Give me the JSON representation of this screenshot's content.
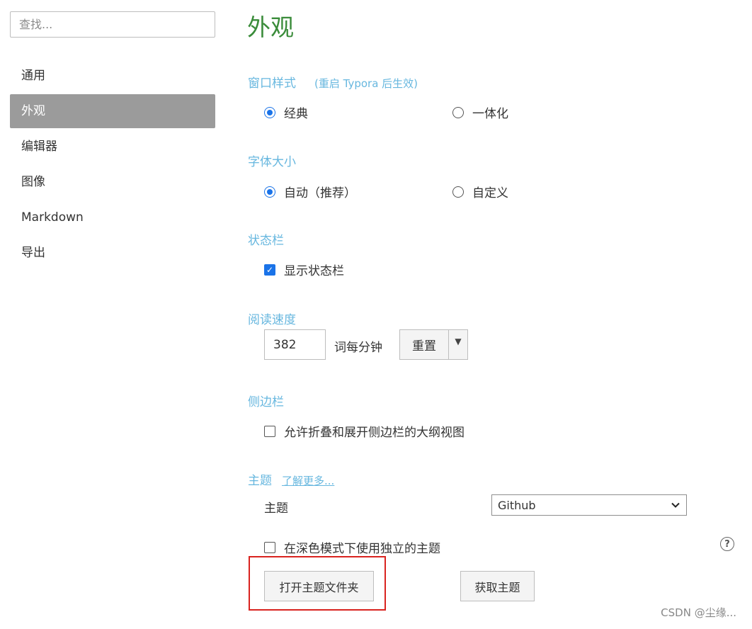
{
  "sidebar": {
    "search_placeholder": "查找...",
    "items": [
      {
        "label": "通用"
      },
      {
        "label": "外观"
      },
      {
        "label": "编辑器"
      },
      {
        "label": "图像"
      },
      {
        "label": "Markdown"
      },
      {
        "label": "导出"
      }
    ],
    "active_index": 1
  },
  "main": {
    "title": "外观",
    "window_style": {
      "title": "窗口样式",
      "note": "(重启 Typora 后生效)",
      "options": [
        "经典",
        "一体化"
      ],
      "selected": "经典"
    },
    "font_size": {
      "title": "字体大小",
      "options": [
        "自动（推荐）",
        "自定义"
      ],
      "selected": "自动（推荐）"
    },
    "status_bar": {
      "title": "状态栏",
      "checkbox_label": "显示状态栏",
      "checked": true
    },
    "reading_speed": {
      "title": "阅读速度",
      "value": "382",
      "unit": "词每分钟",
      "reset_label": "重置"
    },
    "sidebar_section": {
      "title": "侧边栏",
      "checkbox_label": "允许折叠和展开侧边栏的大纲视图",
      "checked": false
    },
    "theme": {
      "title": "主题",
      "learn_more": "了解更多...",
      "theme_label": "主题",
      "selected_theme": "Github",
      "dark_mode_label": "在深色模式下使用独立的主题",
      "dark_mode_checked": false,
      "help_glyph": "?",
      "open_folder_label": "打开主题文件夹",
      "get_themes_label": "获取主题"
    }
  },
  "watermark": "CSDN @尘缘...",
  "colors": {
    "title_green": "#3a8c3a",
    "section_blue": "#67b7df",
    "accent_blue": "#1a73e8",
    "sidebar_active": "#9b9b9b",
    "highlight_red": "#d9231f"
  }
}
